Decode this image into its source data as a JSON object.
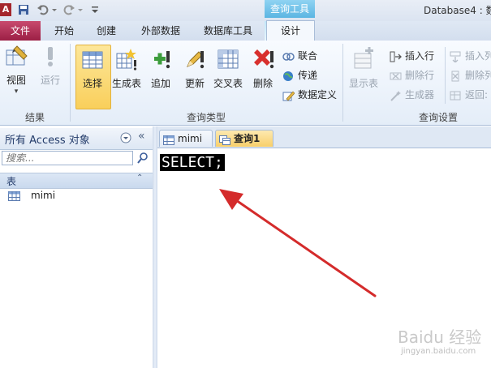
{
  "window": {
    "title": "Database4 : 数",
    "context_tab_group": "查询工具"
  },
  "tabs": [
    {
      "label": "文件"
    },
    {
      "label": "开始"
    },
    {
      "label": "创建"
    },
    {
      "label": "外部数据"
    },
    {
      "label": "数据库工具"
    },
    {
      "label": "设计"
    }
  ],
  "ribbon": {
    "results": {
      "group_label": "结果",
      "view_label": "视图",
      "run_label": "运行"
    },
    "query_type": {
      "group_label": "查询类型",
      "select_label": "选择",
      "make_table_label": "生成表",
      "append_label": "追加",
      "update_label": "更新",
      "crosstab_label": "交叉表",
      "delete_label": "删除",
      "union_label": "联合",
      "passthrough_label": "传递",
      "data_definition_label": "数据定义"
    },
    "query_setup": {
      "group_label": "查询设置",
      "show_table_label": "显示表",
      "insert_rows_label": "插入行",
      "delete_rows_label": "删除行",
      "builder_label": "生成器",
      "insert_columns_label": "插入列",
      "delete_columns_label": "删除列",
      "return_label": "返回:"
    }
  },
  "nav_pane": {
    "title": "所有 Access 对象",
    "search_placeholder": "搜索...",
    "section_label": "表",
    "items": [
      {
        "label": "mimi"
      }
    ]
  },
  "document_tabs": [
    {
      "label": "mimi"
    },
    {
      "label": "查询1"
    }
  ],
  "sql_editor": {
    "text": "SELECT;"
  },
  "watermark": {
    "logo": "Baidu 经验",
    "url": "jingyan.baidu.com"
  },
  "colors": {
    "file_tab": "#b03058",
    "context_tab": "#5bb5e2",
    "selected_button": "#f9cf5b",
    "arrow": "#d42b2b"
  }
}
